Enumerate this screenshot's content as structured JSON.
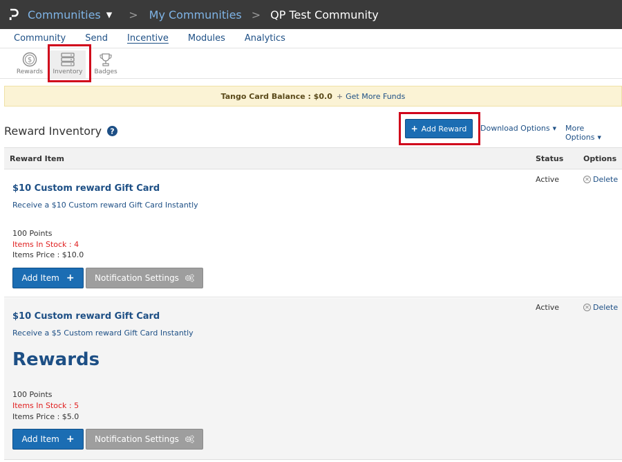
{
  "topbar": {
    "logo_icon": "p-logo-icon",
    "crumbs": [
      "Communities",
      "My Communities",
      "QP Test Community"
    ],
    "separator": ">"
  },
  "main_nav": {
    "items": [
      "Community",
      "Send",
      "Incentive",
      "Modules",
      "Analytics"
    ],
    "active": "Incentive"
  },
  "sub_nav": {
    "items": [
      {
        "label": "Rewards",
        "icon": "dollar-coin-icon"
      },
      {
        "label": "Inventory",
        "icon": "inventory-server-icon"
      },
      {
        "label": "Badges",
        "icon": "trophy-icon"
      }
    ],
    "active": "Inventory"
  },
  "funds": {
    "label": "Tango Card Balance : $0.0",
    "link": "Get More Funds",
    "plus": "+"
  },
  "header": {
    "title": "Reward Inventory",
    "add_reward_label": "Add Reward",
    "download_options": "Download Options",
    "more_options": "More Options"
  },
  "table": {
    "columns": [
      "Reward Item",
      "Status",
      "Options"
    ],
    "rows": [
      {
        "title": "$10 Custom reward Gift Card",
        "description": "Receive a $10 Custom reward Gift Card Instantly",
        "big_text": "",
        "points": "100 Points",
        "stock": "Items In Stock : 4",
        "price": "Items Price : $10.0",
        "status": "Active",
        "delete": "Delete",
        "add_item": "Add Item",
        "notification": "Notification Settings"
      },
      {
        "title": "$10 Custom reward Gift Card",
        "description": "Receive a $5 Custom reward Gift Card Instantly",
        "big_text": "Rewards",
        "points": "100 Points",
        "stock": "Items In Stock : 5",
        "price": "Items Price : $5.0",
        "status": "Active",
        "delete": "Delete",
        "add_item": "Add Item",
        "notification": "Notification Settings"
      }
    ]
  },
  "colors": {
    "topbar": "#3a3a3a",
    "link": "#1d4f85",
    "primary_button": "#1b6db3",
    "highlight_box": "#d0021b",
    "stock_text": "#e02020"
  }
}
